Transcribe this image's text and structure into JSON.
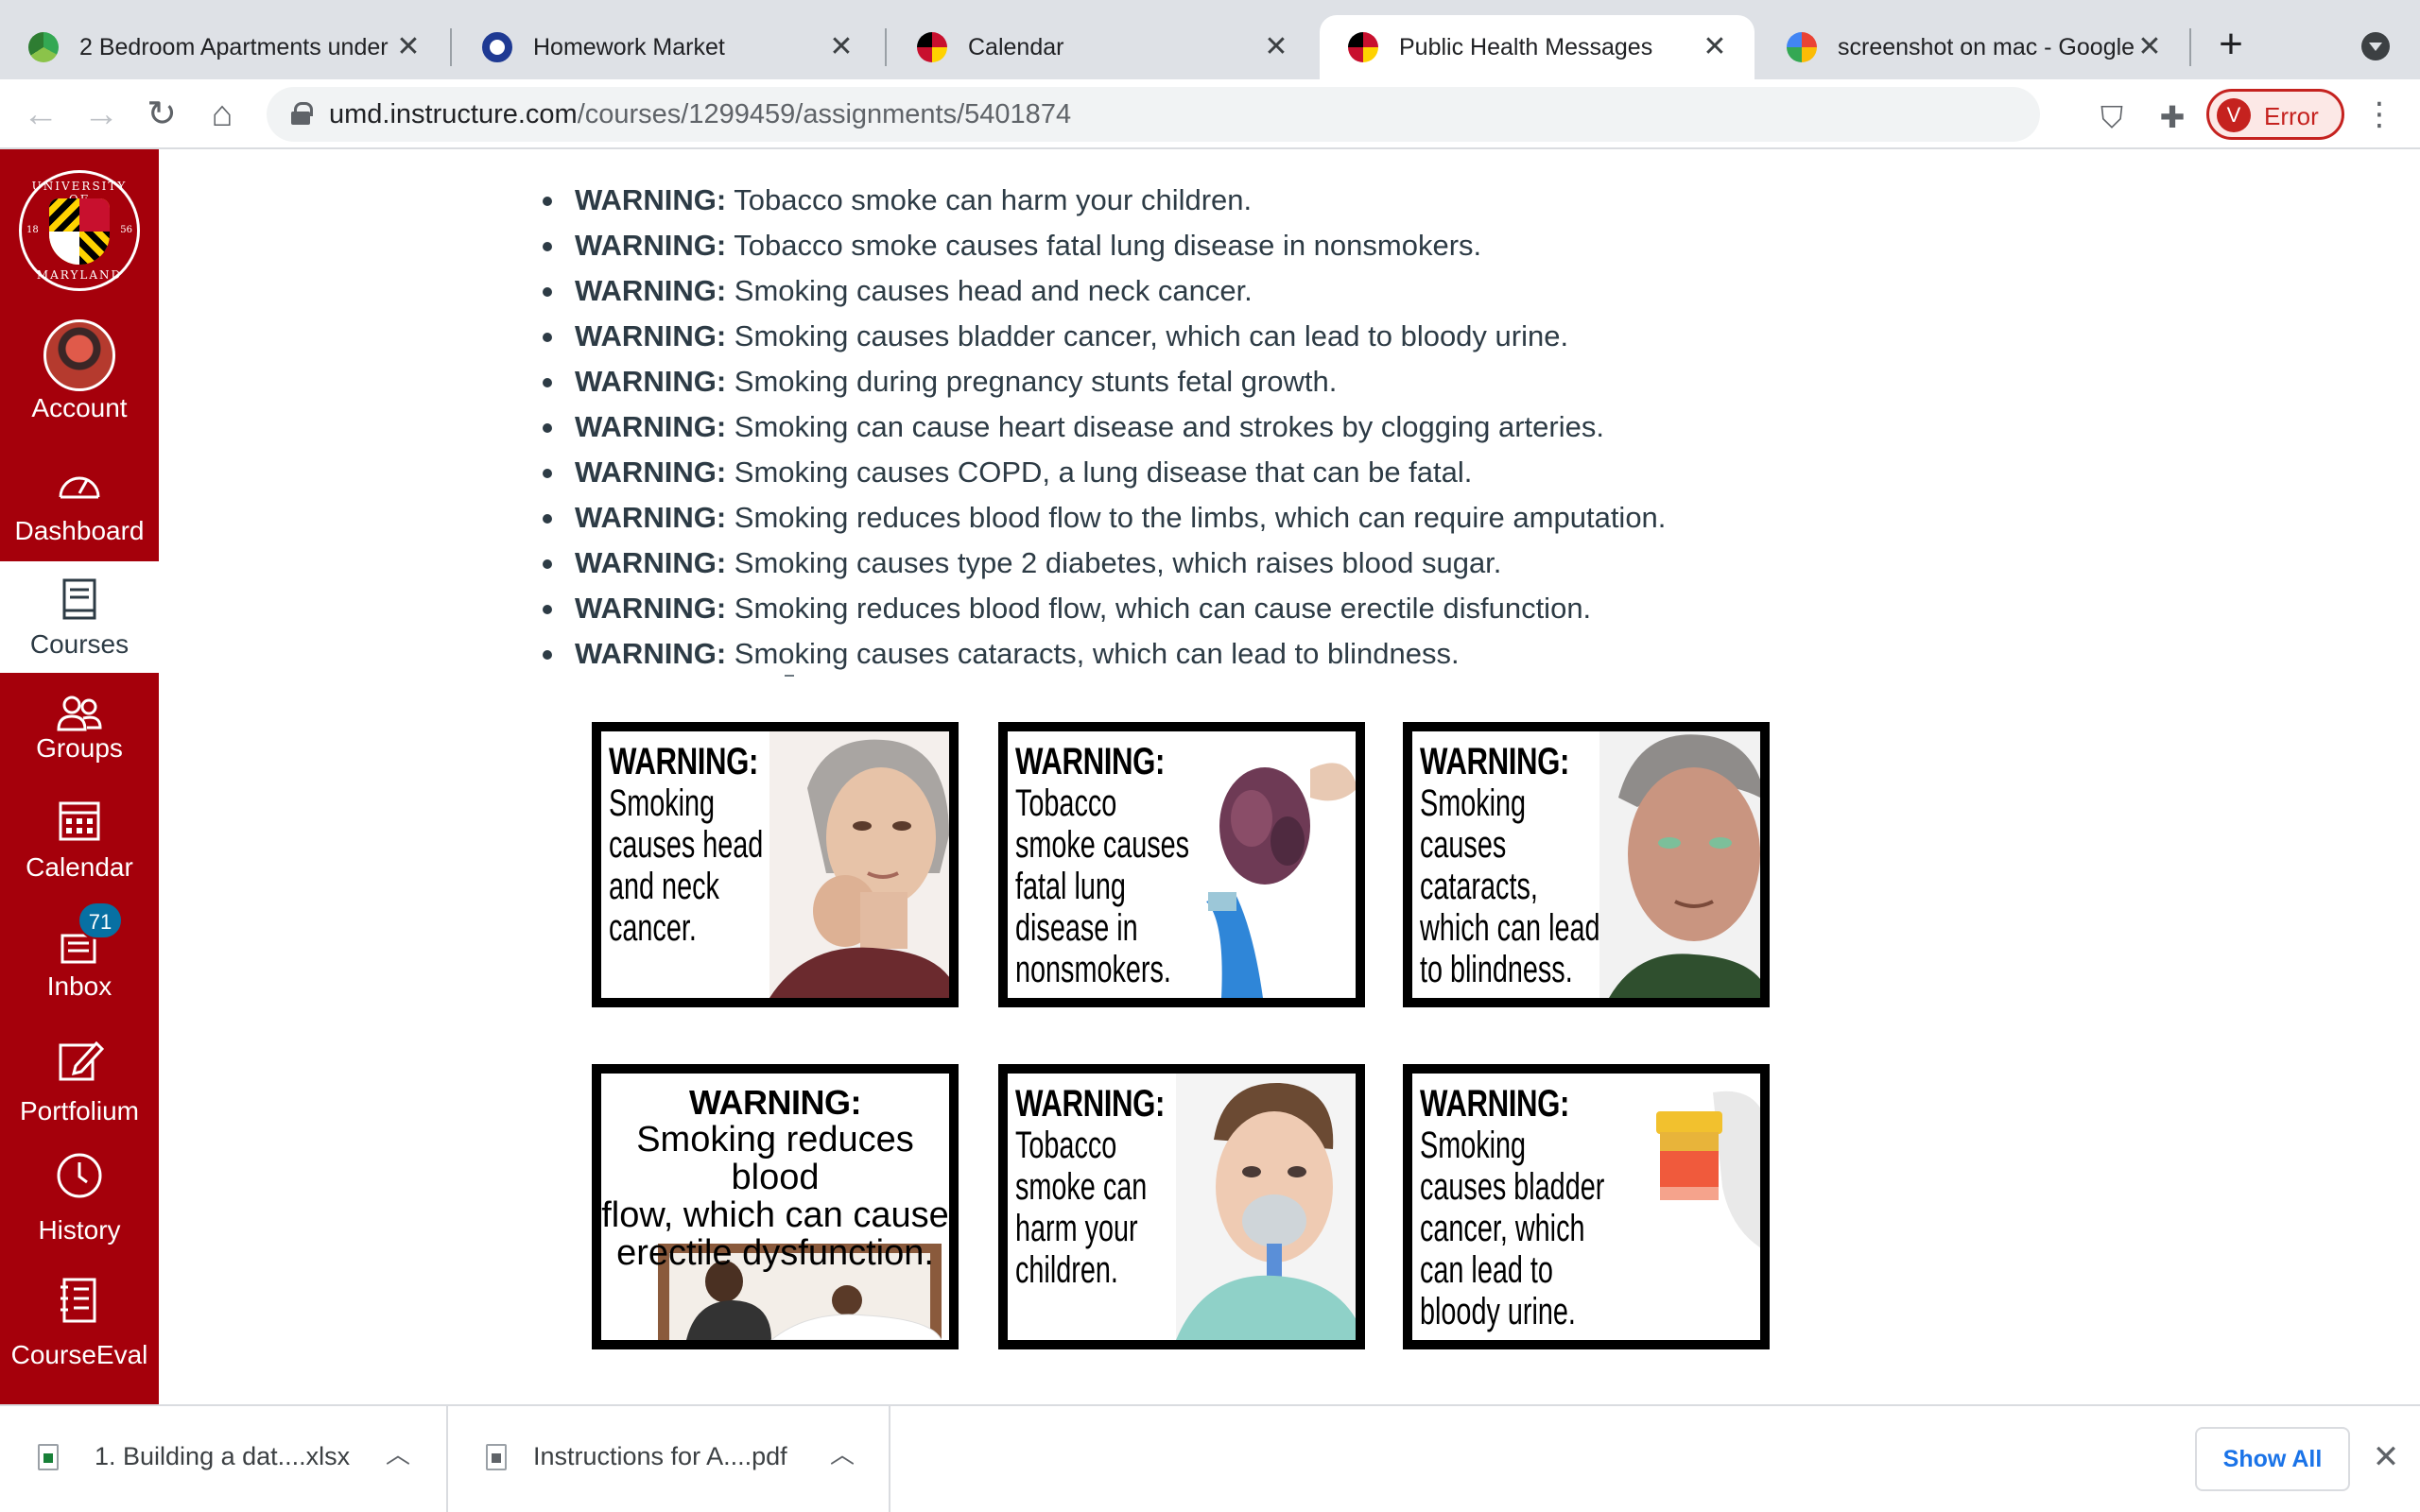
{
  "browser": {
    "tabs": [
      {
        "title": "2 Bedroom Apartments under",
        "icon": "green-recycle-favicon-icon",
        "active": false
      },
      {
        "title": "Homework Market",
        "icon": "homework-market-favicon-icon",
        "active": false
      },
      {
        "title": "Calendar",
        "icon": "umd-favicon-icon",
        "active": false
      },
      {
        "title": "Public Health Messages",
        "icon": "umd-favicon-icon",
        "active": true
      },
      {
        "title": "screenshot on mac - Google",
        "icon": "google-favicon-icon",
        "active": false
      }
    ],
    "new_tab_label": "+",
    "tab_close_glyph": "✕",
    "url_host": "umd.instructure.com",
    "url_path": "/courses/1299459/assignments/5401874",
    "profile_initial": "V",
    "profile_status": "Error"
  },
  "sidebar": {
    "items": [
      {
        "id": "account",
        "label": "Account"
      },
      {
        "id": "dashboard",
        "label": "Dashboard"
      },
      {
        "id": "courses",
        "label": "Courses",
        "active": true
      },
      {
        "id": "groups",
        "label": "Groups"
      },
      {
        "id": "calendar",
        "label": "Calendar"
      },
      {
        "id": "inbox",
        "label": "Inbox",
        "badge": "71"
      },
      {
        "id": "portfolium",
        "label": "Portfolium"
      },
      {
        "id": "history",
        "label": "History"
      },
      {
        "id": "courseeval",
        "label": "CourseEval"
      }
    ],
    "logo": {
      "top_text": "UNIVERSITY OF",
      "bottom_text": "MARYLAND",
      "year_left": "18",
      "year_right": "56"
    },
    "colors": {
      "background": "#a5000b",
      "active_bg": "#ffffff"
    }
  },
  "content": {
    "warning_prefix": "WARNING:",
    "warnings": [
      "Tobacco smoke can harm your children.",
      "Tobacco smoke causes fatal lung disease in nonsmokers.",
      "Smoking causes head and neck cancer.",
      "Smoking causes bladder cancer, which can lead to bloody urine.",
      "Smoking during pregnancy stunts fetal growth.",
      "Smoking can cause heart disease and strokes by clogging arteries.",
      "Smoking causes COPD, a lung disease that can be fatal.",
      "Smoking reduces blood flow to the limbs, which can require amputation.",
      "Smoking causes type 2 diabetes, which raises blood sugar.",
      "Smoking reduces blood flow, which can cause erectile disfunction.",
      "Smoking causes cataracts, which can lead to blindness."
    ],
    "cards": [
      {
        "head": "WARNING:",
        "body": "Smoking\ncauses head\nand neck\ncancer."
      },
      {
        "head": "WARNING:",
        "body": "Tobacco\nsmoke causes\nfatal lung\ndisease in\nnonsmokers."
      },
      {
        "head": "WARNING:",
        "body": "Smoking\ncauses\ncataracts,\nwhich can lead\nto blindness."
      },
      {
        "head": "WARNING:",
        "body": "Smoking reduces blood\nflow, which can cause\nerectile dysfunction."
      },
      {
        "head": "WARNING:",
        "body": "Tobacco\nsmoke can\nharm your\nchildren."
      },
      {
        "head": "WARNING:",
        "body": "Smoking\ncauses bladder\ncancer, which\ncan lead to\nbloody urine."
      }
    ]
  },
  "downloads": {
    "items": [
      {
        "name": "1. Building a dat....xlsx",
        "type": "xlsx"
      },
      {
        "name": "Instructions for A....pdf",
        "type": "pdf"
      }
    ],
    "show_all_label": "Show All",
    "close_glyph": "✕"
  }
}
